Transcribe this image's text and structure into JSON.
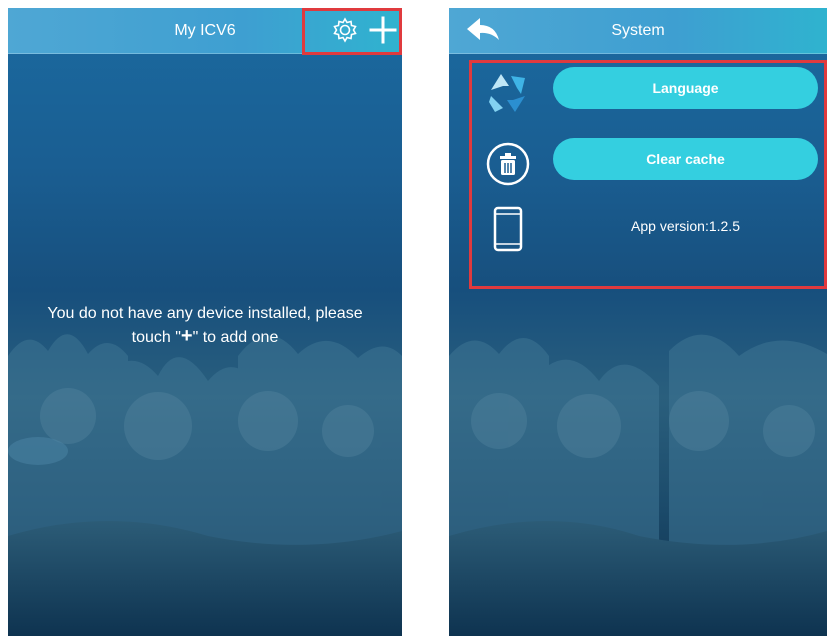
{
  "left_screen": {
    "header": {
      "title": "My ICV6",
      "icons": [
        "gear-icon",
        "plus-icon"
      ]
    },
    "empty_message": {
      "line1": "You do not have any device installed, please",
      "line2_prefix": "touch \"",
      "line2_plus": "+",
      "line2_suffix": "\" to add one"
    }
  },
  "right_screen": {
    "header": {
      "title": "System",
      "icons": [
        "back-arrow-icon"
      ]
    },
    "settings": {
      "language_label": "Language",
      "clear_cache_label": "Clear cache",
      "app_version_text": "App version:1.2.5",
      "row_icons": [
        "language-recycle-icon",
        "trash-icon",
        "phone-icon"
      ]
    }
  },
  "colors": {
    "header_gradient_start": "#4fa7d4",
    "header_gradient_end": "#2fb3cf",
    "button_fill": "#34cfe0",
    "highlight_box": "#e03a3e",
    "text": "#ffffff"
  }
}
